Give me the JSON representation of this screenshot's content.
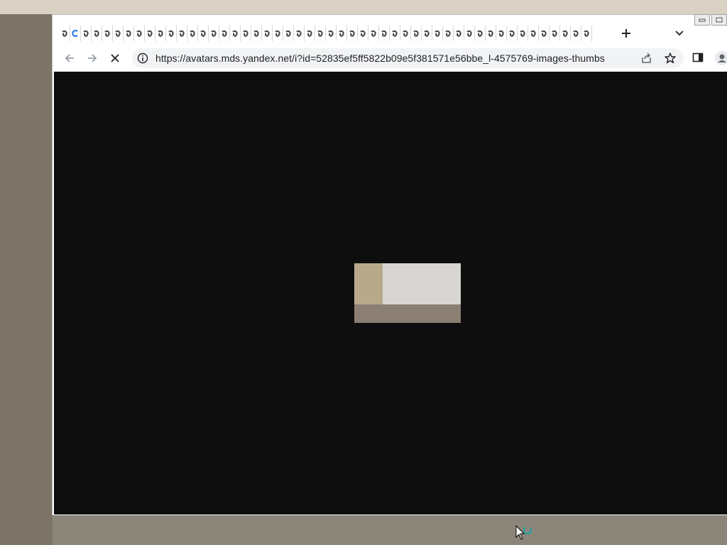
{
  "browser": {
    "tab_count": 50,
    "active_tab_index": 1,
    "address_bar": {
      "url": "https://avatars.mds.yandex.net/i?id=52835ef5ff5822b09e5f381571e56bbe_l-4575769-images-thumbs"
    },
    "loading": true
  },
  "icons": {
    "tab_favicon": "spiral-favicon-icon",
    "new_tab": "plus-icon",
    "tab_search": "chevron-down-icon",
    "back": "back-arrow-icon",
    "forward": "forward-arrow-icon",
    "stop": "close-icon",
    "site_info": "info-icon",
    "share": "share-icon",
    "bookmark": "star-icon",
    "side_panel": "side-panel-icon",
    "profile": "profile-icon",
    "cursor": "pointer-busy-icon"
  },
  "colors": {
    "viewport_background": "#0e0e0e",
    "omnibox_background": "#f1f3f4",
    "active_favicon": "#1a73e8"
  }
}
